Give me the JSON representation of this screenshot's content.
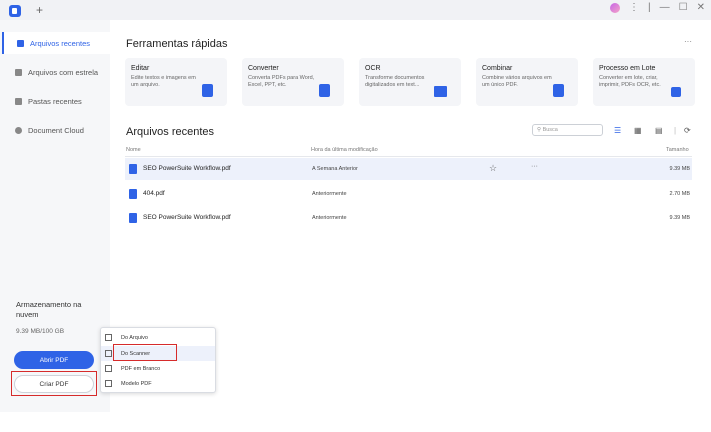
{
  "titlebar": {
    "new_tab": "+",
    "ctrls": [
      "⋮",
      "|",
      "—",
      "☐",
      "✕"
    ]
  },
  "sidebar": {
    "items": [
      {
        "label": "Arquivos recentes"
      },
      {
        "label": "Arquivos com estrela"
      },
      {
        "label": "Pastas recentes"
      },
      {
        "label": "Document Cloud"
      }
    ],
    "storage_title": "Armazenamento na nuvem",
    "storage_value": "9.39 MB/100 GB",
    "open_pdf": "Abrir PDF",
    "create_pdf": "Criar PDF"
  },
  "quick_tools": {
    "title": "Ferramentas rápidas",
    "more": "···",
    "cards": [
      {
        "name": "Editar",
        "desc": "Edite textos e imagens em um arquivo.",
        "color": "#2f63e6"
      },
      {
        "name": "Converter",
        "desc": "Converta PDFs para Word, Excel, PPT, etc.",
        "color": "#2f63e6"
      },
      {
        "name": "OCR",
        "desc": "Transforme documentos digitalizados em text...",
        "color": "#2f63e6"
      },
      {
        "name": "Combinar",
        "desc": "Combine vários arquivos em um único PDF.",
        "color": "#2f63e6"
      },
      {
        "name": "Processo em Lote",
        "desc": "Converter em lote, criar, imprimir, PDFs OCR, etc.",
        "color": "#2f63e6"
      }
    ]
  },
  "recent": {
    "title": "Arquivos recentes",
    "search_placeholder": "Busca",
    "col_name": "Nome",
    "col_date": "Hora da última modificação",
    "col_size": "Tamanho",
    "rows": [
      {
        "name": "SEO PowerSuite Workflow.pdf",
        "date": "A Semana Anterior",
        "size": "9.39 MB"
      },
      {
        "name": "404.pdf",
        "date": "Anteriormente",
        "size": "2.70 MB"
      },
      {
        "name": "SEO PowerSuite Workflow.pdf",
        "date": "Anteriormente",
        "size": "9.39 MB"
      }
    ]
  },
  "create_menu": {
    "items": [
      {
        "label": "Do Arquivo"
      },
      {
        "label": "Do Scanner"
      },
      {
        "label": "PDF em Branco"
      },
      {
        "label": "Modelo PDF"
      }
    ]
  }
}
